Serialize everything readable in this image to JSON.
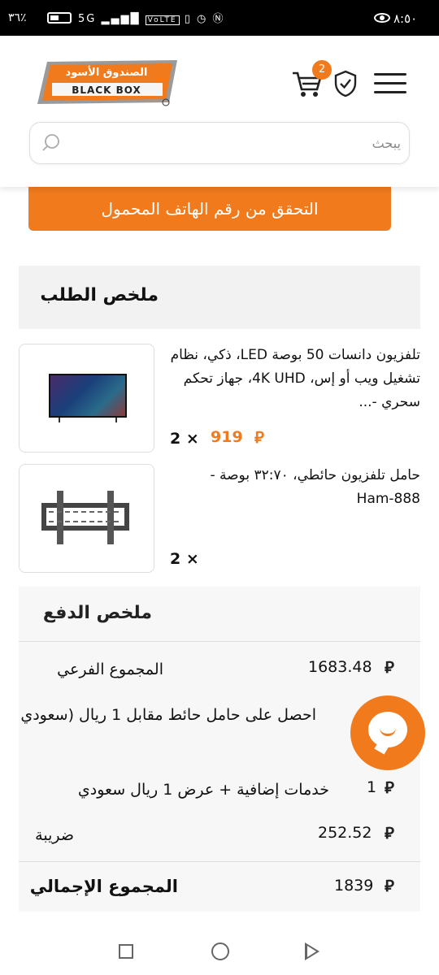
{
  "status_bar": {
    "time": "٨:٥٠",
    "battery": "٣٦٪",
    "network": "5G",
    "volte": "VoLTE"
  },
  "header": {
    "logo_ar": "الصندوق الأسود",
    "logo_en": "BLACK BOX",
    "cart_count": "2",
    "search_placeholder": "يبحث"
  },
  "verify_button": "التحقق من رقم الهاتف المحمول",
  "order_summary": {
    "title": "ملخص الطلب",
    "items": [
      {
        "name": "تلفزيون دانسات 50 بوصة LED، ذكي، نظام تشغيل ويب أو إس، 4K UHD، جهاز تحكم سحري -...",
        "price": "919",
        "qty": "2 ×",
        "image": "tv-image"
      },
      {
        "name": "حامل تلفزيون حائطي، ٣٢:٧٠ بوصة - Ham-888",
        "price": "",
        "qty": "2 ×",
        "image": "wall-mount-image"
      }
    ]
  },
  "payment_summary": {
    "title": "ملخص الدفع",
    "rows": [
      {
        "label": "المجموع الفرعي",
        "value": "1683.48"
      },
      {
        "label": "احصل على حامل حائط مقابل 1 ريال (سعودي",
        "value": ""
      },
      {
        "label": "خدمات إضافية + عرض 1 ريال سعودي",
        "value": "1"
      },
      {
        "label": "ضريبة",
        "value": "252.52"
      }
    ],
    "total_label": "المجموع الإجمالي",
    "total_value": "1839"
  },
  "colors": {
    "accent": "#f07a1c",
    "panel": "#f2f2f2",
    "text": "#111111"
  },
  "icons": {
    "menu": "menu-icon",
    "cart": "cart-icon",
    "shield": "shield-check-icon",
    "search": "search-icon",
    "chat": "chat-icon",
    "currency": "riyal-icon"
  }
}
